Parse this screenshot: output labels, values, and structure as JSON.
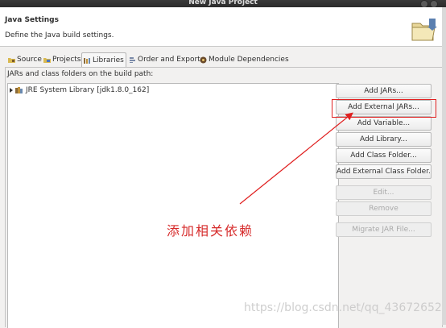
{
  "window": {
    "title": "New Java Project"
  },
  "header": {
    "title": "Java Settings",
    "description": "Define the Java build settings."
  },
  "tabs": [
    {
      "label": "Source",
      "icon": "source-folder-icon",
      "active": false
    },
    {
      "label": "Projects",
      "icon": "projects-icon",
      "active": false
    },
    {
      "label": "Libraries",
      "icon": "libraries-icon",
      "active": true
    },
    {
      "label": "Order and Export",
      "icon": "order-export-icon",
      "active": false
    },
    {
      "label": "Module Dependencies",
      "icon": "module-icon",
      "active": false
    }
  ],
  "libraries": {
    "label": "JARs and class folders on the build path:",
    "tree": [
      {
        "label": "JRE System Library [jdk1.8.0_162]",
        "icon": "library-icon",
        "expanded": false
      }
    ],
    "buttons": [
      {
        "label": "Add JARs...",
        "enabled": true
      },
      {
        "label": "Add External JARs...",
        "enabled": true
      },
      {
        "label": "Add Variable...",
        "enabled": true
      },
      {
        "label": "Add Library...",
        "enabled": true
      },
      {
        "label": "Add Class Folder...",
        "enabled": true
      },
      {
        "label": "Add External Class Folder...",
        "enabled": true
      },
      {
        "label": "Edit...",
        "enabled": false
      },
      {
        "label": "Remove",
        "enabled": false
      },
      {
        "label": "Migrate JAR File...",
        "enabled": false
      }
    ]
  },
  "annotation": {
    "text": "添加相关依赖",
    "color": "#d62a2a"
  },
  "watermark": {
    "text": "https://blog.csdn.net/qq_43672652"
  }
}
